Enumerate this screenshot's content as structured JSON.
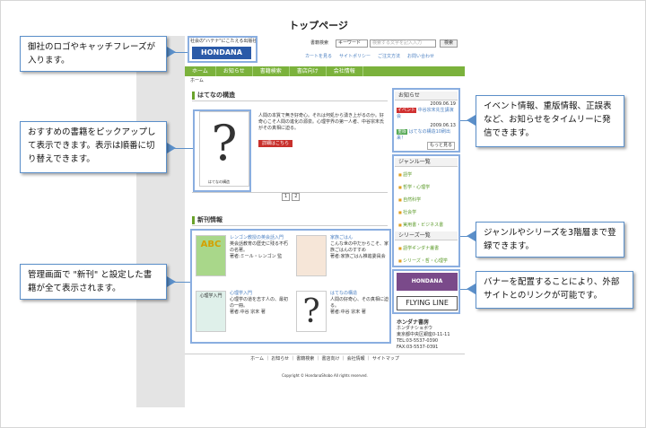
{
  "page_title": "トップページ",
  "site": {
    "tagline": "社会の\"ハテナ\"にこたえる出版社",
    "logo": "HONDANA",
    "search_label": "書籍検索",
    "search_select": "キーワード",
    "search_placeholder": "検索する文字を記入入力",
    "search_button": "検索",
    "utility_links": [
      "カートを見る",
      "サイトポリシー",
      "ご注文方法",
      "お問い合わせ"
    ],
    "nav": [
      "ホーム",
      "お知らせ",
      "書籍検索",
      "書店向け",
      "会社情報"
    ],
    "breadcrumb": "ホーム",
    "featured": {
      "heading": "はてなの構造",
      "text": "人間の本質で無き好奇心。それは何処から湧き上がるのか。好奇心こそ人間の進化の源泉。心理学界の第一人者、中谷宗末氏がその真相に迫る。",
      "button": "詳細はこちら",
      "cover_caption": "はてなの構造",
      "pager": [
        "1",
        "2"
      ]
    },
    "new_books": {
      "heading": "新刊情報",
      "items": [
        {
          "title": "レンゴン教授の英会話入門",
          "desc": "英会話教育の歴史に残る不朽の名著。",
          "author": "著者:ミール・レンゴン 監",
          "cover": "ABC"
        },
        {
          "title": "家族ごはん",
          "desc": "こんな世の中だからこそ、家族ごはんのすすめ",
          "author": "著者:家族ごはん推進委員会",
          "cover": ""
        },
        {
          "title": "心理学入門",
          "desc": "心理学の道を志す人の、最初の一冊。",
          "author": "著者:中谷 宗末 著",
          "cover": "心理学入門"
        },
        {
          "title": "はてなの構造",
          "desc": "人間の好奇心、その真相に迫る。",
          "author": "著者:中谷 宗末 著",
          "cover": "?"
        }
      ]
    },
    "news": {
      "heading": "お知らせ",
      "items": [
        {
          "date": "2009.06.19",
          "tag": "イベント",
          "text": "中谷宗末先生講演会"
        },
        {
          "date": "2009.06.13",
          "tag": "重版",
          "text": "はてなの構造10刷出来！"
        }
      ],
      "more": "もっと見る"
    },
    "genre": {
      "heading": "ジャンル一覧",
      "items": [
        "語学",
        "哲学・心理学",
        "自然科学",
        "社会学",
        "実用書・ビジネス書"
      ]
    },
    "series": {
      "heading": "シリーズ一覧",
      "items": [
        "語学ギンダナ叢書",
        "シリーズ・哲・心理学"
      ]
    },
    "banners": [
      "HONDANA",
      "FLYING LINE"
    ],
    "company": {
      "name": "ホンダナ書房",
      "kana": "ホンダナショボウ",
      "address": "東京都中央区銀座0-11-11",
      "tel": "TEL:03-5537-0390",
      "fax": "FAX:03-5537-0391"
    },
    "footer_links": "ホーム ｜ お知らせ ｜ 書籍検索 ｜ 書店向け ｜ 会社情報 ｜ サイトマップ",
    "copyright": "Copyright © HondanaShobo All rights reserved."
  },
  "notes": {
    "logo": "御社のロゴやキャッチフレーズが入ります。",
    "featured": "おすすめの書籍をピックアップして表示できます。表示は順番に切り替えできます。",
    "new_books": "管理画面で \"新刊\" と設定した書籍が全て表示されます。",
    "news": "イベント情報、重版情報、正誤表など、お知らせをタイムリーに発信できます。",
    "genre": "ジャンルやシリーズを3階層まで登録できます。",
    "banner": "バナーを配置することにより、外部サイトとのリンクが可能です。"
  }
}
